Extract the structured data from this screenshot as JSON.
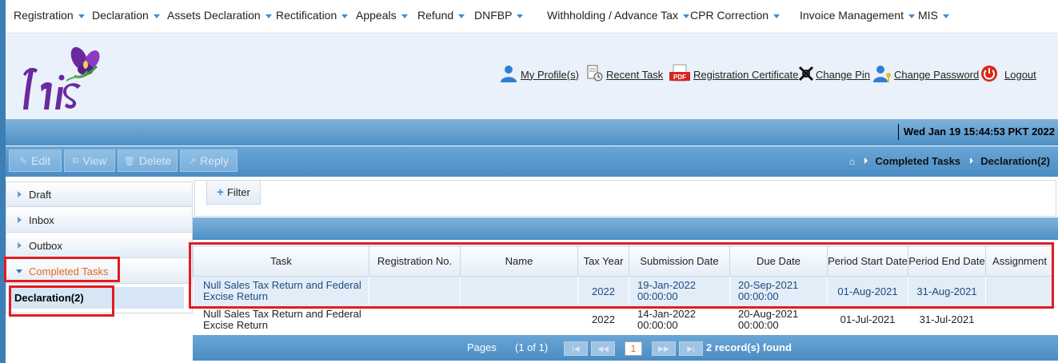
{
  "nav": {
    "items": [
      {
        "label": "Registration"
      },
      {
        "label": "Declaration"
      },
      {
        "label": "Assets Declaration"
      },
      {
        "label": "Rectification"
      },
      {
        "label": "Appeals"
      },
      {
        "label": "Refund"
      },
      {
        "label": "DNFBP"
      },
      {
        "label": "Withholding / Advance Tax"
      },
      {
        "label": "CPR Correction"
      },
      {
        "label": "Invoice Management"
      },
      {
        "label": "MIS"
      }
    ]
  },
  "header": {
    "logo_text": "Iris",
    "links": {
      "profile": "My Profile(s)",
      "recent": "Recent Task",
      "certificate": "Registration Certificate",
      "pin": "Change Pin",
      "password": "Change Password",
      "logout": "Logout"
    },
    "pdf_label": "PDF"
  },
  "datetime": "Wed Jan 19 15:44:53 PKT 2022",
  "toolbar": {
    "edit": "Edit",
    "view": "View",
    "delete": "Delete",
    "reply": "Reply"
  },
  "breadcrumb": {
    "level1": "Completed Tasks",
    "level2": "Declaration(2)"
  },
  "sidebar": {
    "draft": "Draft",
    "inbox": "Inbox",
    "outbox": "Outbox",
    "completed": "Completed Tasks",
    "declaration": "Declaration(2)"
  },
  "filter": {
    "label": "Filter"
  },
  "grid": {
    "columns": {
      "task": "Task",
      "reg_no": "Registration No.",
      "name": "Name",
      "tax_year": "Tax Year",
      "submission_date": "Submission Date",
      "due_date": "Due Date",
      "period_start": "Period Start Date",
      "period_end": "Period End Date",
      "assignment": "Assignment"
    },
    "rows": [
      {
        "task": "Null Sales Tax Return and Federal Excise Return",
        "reg_no": "",
        "name": "",
        "tax_year": "2022",
        "submission_date": "19-Jan-2022",
        "submission_time": "00:00:00",
        "due_date": "20-Sep-2021",
        "due_time": "00:00:00",
        "period_start": "01-Aug-2021",
        "period_end": "31-Aug-2021",
        "assignment": ""
      },
      {
        "task": "Null Sales Tax Return and Federal Excise Return",
        "reg_no": "",
        "name": "",
        "tax_year": "2022",
        "submission_date": "14-Jan-2022",
        "submission_time": "00:00:00",
        "due_date": "20-Aug-2021",
        "due_time": "00:00:00",
        "period_start": "01-Jul-2021",
        "period_end": "31-Jul-2021",
        "assignment": ""
      }
    ]
  },
  "pager": {
    "pages_label": "Pages",
    "page_info": "(1 of 1)",
    "current_page": "1",
    "records": "2 record(s) found"
  },
  "colors": {
    "accent_blue": "#4a8cc2",
    "highlight_red": "#e11b22",
    "active_orange": "#e46a1b"
  }
}
